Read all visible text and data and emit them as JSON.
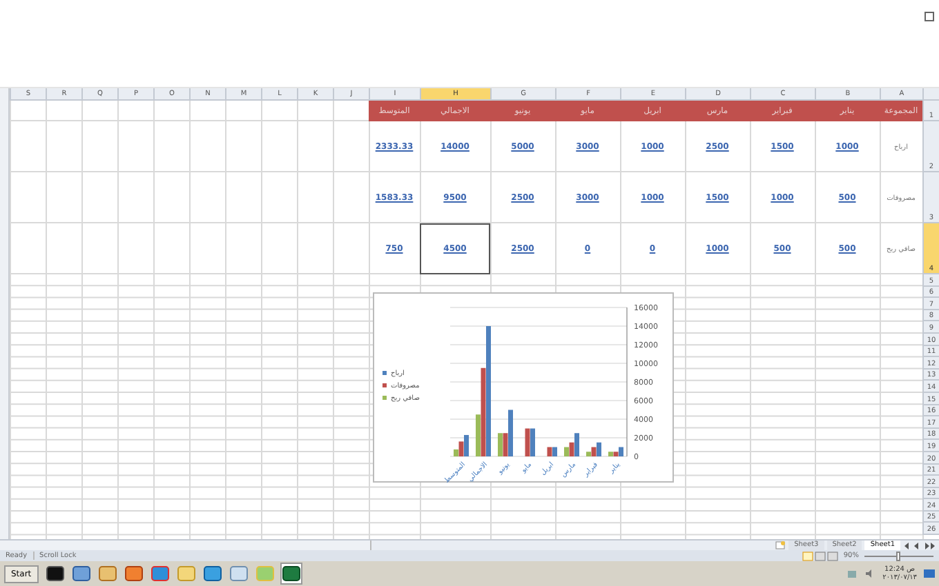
{
  "columns": [
    {
      "label": "A",
      "selected": false
    },
    {
      "label": "B",
      "selected": false
    },
    {
      "label": "C",
      "selected": false
    },
    {
      "label": "D",
      "selected": false
    },
    {
      "label": "E",
      "selected": false
    },
    {
      "label": "F",
      "selected": false
    },
    {
      "label": "G",
      "selected": false
    },
    {
      "label": "H",
      "selected": true
    },
    {
      "label": "I",
      "selected": false
    },
    {
      "label": "J",
      "selected": false
    },
    {
      "label": "K",
      "selected": false
    },
    {
      "label": "L",
      "selected": false
    },
    {
      "label": "M",
      "selected": false
    },
    {
      "label": "N",
      "selected": false
    },
    {
      "label": "O",
      "selected": false
    },
    {
      "label": "P",
      "selected": false
    },
    {
      "label": "Q",
      "selected": false
    },
    {
      "label": "R",
      "selected": false
    },
    {
      "label": "S",
      "selected": false
    }
  ],
  "rows": [
    {
      "number": "1",
      "selected": false,
      "kind": "header",
      "cells": [
        {
          "text": "المجموعة",
          "selected": false
        },
        {
          "text": "يناير",
          "selected": false
        },
        {
          "text": "فبراير",
          "selected": false
        },
        {
          "text": "مارس",
          "selected": false
        },
        {
          "text": "ابريل",
          "selected": false
        },
        {
          "text": "مايو",
          "selected": false
        },
        {
          "text": "يونيو",
          "selected": false
        },
        {
          "text": "الاجمالي",
          "selected": false
        },
        {
          "text": "المتوسط",
          "selected": false
        }
      ]
    },
    {
      "number": "2",
      "selected": false,
      "kind": "data",
      "cells": [
        {
          "text": "ارباح",
          "selected": false
        },
        {
          "text": "1000",
          "selected": false
        },
        {
          "text": "1500",
          "selected": false
        },
        {
          "text": "2500",
          "selected": false
        },
        {
          "text": "1000",
          "selected": false
        },
        {
          "text": "3000",
          "selected": false
        },
        {
          "text": "5000",
          "selected": false
        },
        {
          "text": "14000",
          "selected": false
        },
        {
          "text": "2333.33",
          "selected": false
        }
      ]
    },
    {
      "number": "3",
      "selected": false,
      "kind": "data",
      "cells": [
        {
          "text": "مصروفات",
          "selected": false
        },
        {
          "text": "500",
          "selected": false
        },
        {
          "text": "1000",
          "selected": false
        },
        {
          "text": "1500",
          "selected": false
        },
        {
          "text": "1000",
          "selected": false
        },
        {
          "text": "3000",
          "selected": false
        },
        {
          "text": "2500",
          "selected": false
        },
        {
          "text": "9500",
          "selected": false
        },
        {
          "text": "1583.33",
          "selected": false
        }
      ]
    },
    {
      "number": "4",
      "selected": true,
      "kind": "data",
      "cells": [
        {
          "text": "صافي ربح",
          "selected": false
        },
        {
          "text": "500",
          "selected": false
        },
        {
          "text": "500",
          "selected": false
        },
        {
          "text": "1000",
          "selected": false
        },
        {
          "text": "0",
          "selected": false
        },
        {
          "text": "0",
          "selected": false
        },
        {
          "text": "2500",
          "selected": false
        },
        {
          "text": "4500",
          "selected": true
        },
        {
          "text": "750",
          "selected": false
        }
      ]
    },
    {
      "number": "5",
      "selected": false,
      "kind": "empty"
    },
    {
      "number": "6",
      "selected": false,
      "kind": "empty"
    },
    {
      "number": "7",
      "selected": false,
      "kind": "empty"
    },
    {
      "number": "8",
      "selected": false,
      "kind": "empty"
    },
    {
      "number": "9",
      "selected": false,
      "kind": "empty"
    },
    {
      "number": "10",
      "selected": false,
      "kind": "empty"
    },
    {
      "number": "11",
      "selected": false,
      "kind": "empty"
    },
    {
      "number": "12",
      "selected": false,
      "kind": "empty"
    },
    {
      "number": "13",
      "selected": false,
      "kind": "empty"
    },
    {
      "number": "14",
      "selected": false,
      "kind": "empty"
    },
    {
      "number": "15",
      "selected": false,
      "kind": "empty"
    },
    {
      "number": "16",
      "selected": false,
      "kind": "empty"
    },
    {
      "number": "17",
      "selected": false,
      "kind": "empty"
    },
    {
      "number": "18",
      "selected": false,
      "kind": "empty"
    },
    {
      "number": "19",
      "selected": false,
      "kind": "empty"
    },
    {
      "number": "20",
      "selected": false,
      "kind": "empty"
    },
    {
      "number": "21",
      "selected": false,
      "kind": "empty"
    },
    {
      "number": "22",
      "selected": false,
      "kind": "empty"
    },
    {
      "number": "23",
      "selected": false,
      "kind": "empty"
    },
    {
      "number": "24",
      "selected": false,
      "kind": "empty"
    },
    {
      "number": "25",
      "selected": false,
      "kind": "empty"
    },
    {
      "number": "26",
      "selected": false,
      "kind": "empty"
    }
  ],
  "chart": {
    "chart_data": {
      "type": "bar",
      "categories": [
        "المتوسط",
        "الاجمالي",
        "يونيو",
        "مايو",
        "ابريل",
        "مارس",
        "فبراير",
        "يناير"
      ],
      "series": [
        {
          "name": "ارباح",
          "color": "#4f81bd",
          "values": [
            2300,
            14000,
            5000,
            3000,
            1000,
            2500,
            1500,
            1000
          ]
        },
        {
          "name": "مصروفات",
          "color": "#c0504d",
          "values": [
            1600,
            9500,
            2500,
            3000,
            1000,
            1500,
            1000,
            500
          ]
        },
        {
          "name": "صافي ربح",
          "color": "#9bbb59",
          "values": [
            750,
            4500,
            2500,
            0,
            0,
            1000,
            500,
            500
          ]
        }
      ],
      "ylim": [
        0,
        16000
      ],
      "yticks": [
        {
          "value": 0,
          "label": "0"
        },
        {
          "value": 2000,
          "label": "2000"
        },
        {
          "value": 4000,
          "label": "4000"
        },
        {
          "value": 6000,
          "label": "6000"
        },
        {
          "value": 8000,
          "label": "8000"
        },
        {
          "value": 10000,
          "label": "10000"
        },
        {
          "value": 12000,
          "label": "12000"
        },
        {
          "value": 14000,
          "label": "14000"
        },
        {
          "value": 16000,
          "label": "16000"
        }
      ],
      "grid": true,
      "legend": true
    }
  },
  "sheet_tabs": [
    {
      "label": "Sheet1",
      "selected": true
    },
    {
      "label": "Sheet2",
      "selected": false
    },
    {
      "label": "Sheet3",
      "selected": false
    }
  ],
  "status_bar": {
    "ready": "Ready",
    "scroll_lock": "Scroll Lock",
    "zoom": "90%",
    "zoom_slider": {
      "level": 0.45
    }
  },
  "taskbar": {
    "start": "Start",
    "clock_time": "12:24 ص",
    "clock_date": "٢٠١٣/٠٧/١٣"
  }
}
